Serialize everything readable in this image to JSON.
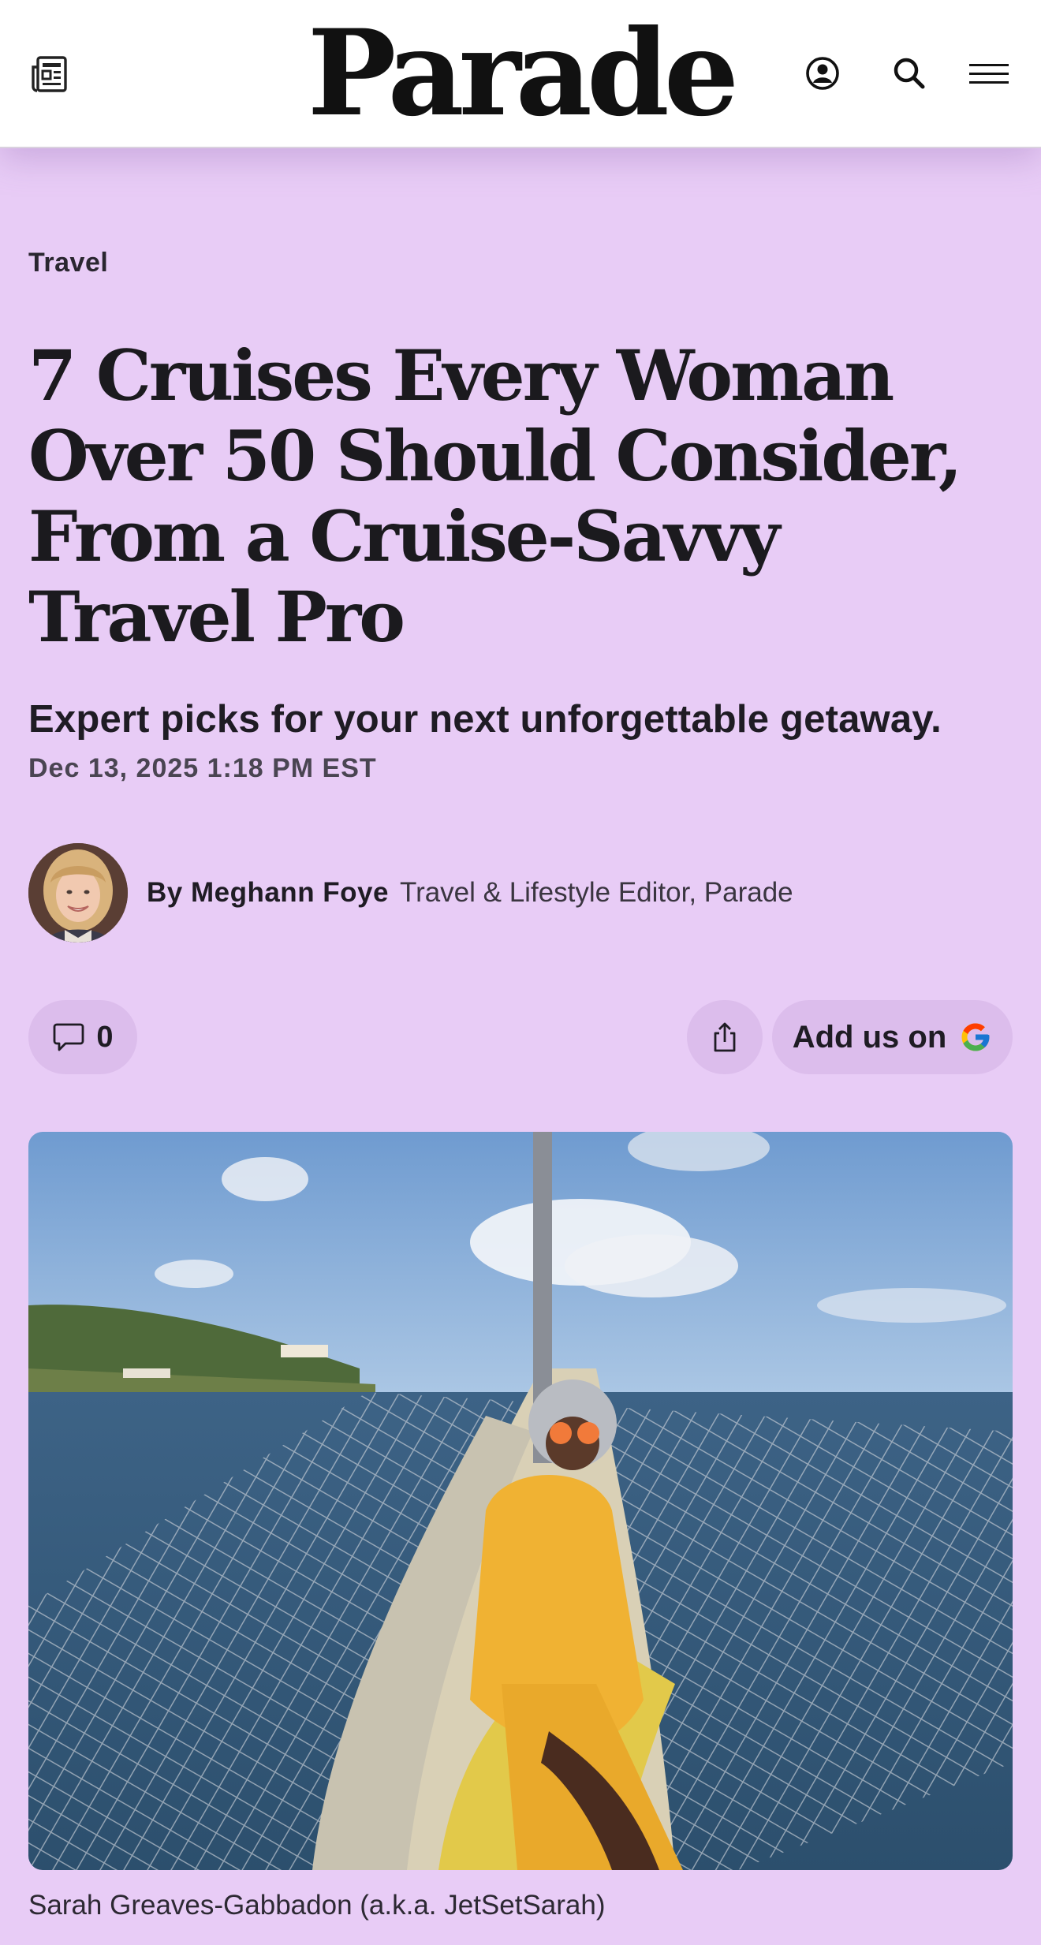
{
  "header": {
    "logo": "Parade",
    "icons": [
      "newspaper-icon",
      "account-icon",
      "search-icon",
      "menu-icon"
    ]
  },
  "article": {
    "category": "Travel",
    "headline": "7 Cruises Every Woman Over 50 Should Consider, From a Cruise-Savvy Travel Pro",
    "subheadline": "Expert picks for your next unforgettable getaway.",
    "date": "Dec 13, 2025 1:18 PM EST",
    "author": {
      "byline": "By Meghann Foye",
      "role": "Travel & Lifestyle Editor, Parade"
    },
    "actions": {
      "comment_count": "0",
      "add_us_label": "Add us on"
    },
    "image_caption": "Sarah Greaves-Gabbadon (a.k.a. JetSetSarah)"
  },
  "colors": {
    "background": "#e8ccf6",
    "pill": "#dcbdec",
    "header": "#ffffff",
    "text": "#1d1b20"
  }
}
